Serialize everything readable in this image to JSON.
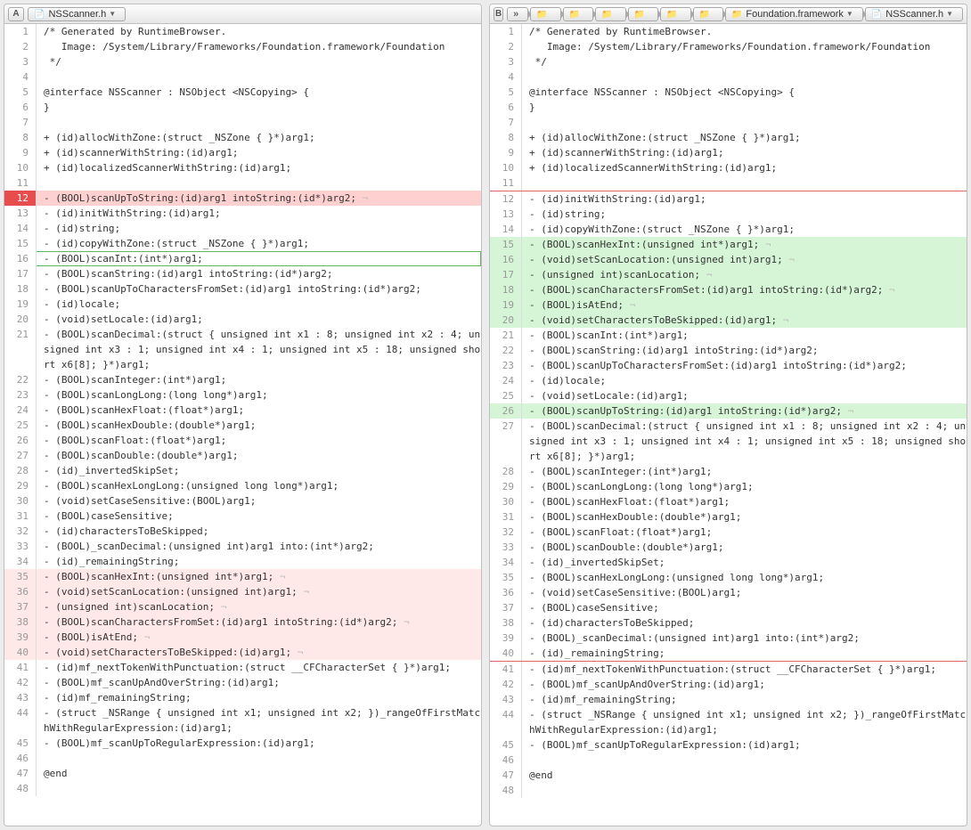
{
  "left": {
    "badge": "A",
    "filename": "NSScanner.h",
    "lines": [
      {
        "n": 1,
        "t": "/* Generated by RuntimeBrowser."
      },
      {
        "n": 2,
        "t": "   Image: /System/Library/Frameworks/Foundation.framework/Foundation"
      },
      {
        "n": 3,
        "t": " */"
      },
      {
        "n": 4,
        "t": ""
      },
      {
        "n": 5,
        "t": "@interface NSScanner : NSObject <NSCopying> {"
      },
      {
        "n": 6,
        "t": "}"
      },
      {
        "n": 7,
        "t": ""
      },
      {
        "n": 8,
        "t": "+ (id)allocWithZone:(struct _NSZone { }*)arg1;"
      },
      {
        "n": 9,
        "t": "+ (id)scannerWithString:(id)arg1;"
      },
      {
        "n": 10,
        "t": "+ (id)localizedScannerWithString:(id)arg1;"
      },
      {
        "n": 11,
        "t": ""
      },
      {
        "n": 12,
        "t": "- (BOOL)scanUpToString:(id)arg1 intoString:(id*)arg2; ¬",
        "cls": "row-del-strong"
      },
      {
        "n": 13,
        "t": "- (id)initWithString:(id)arg1;"
      },
      {
        "n": 14,
        "t": "- (id)string;"
      },
      {
        "n": 15,
        "t": "- (id)copyWithZone:(struct _NSZone { }*)arg1;"
      },
      {
        "n": 16,
        "t": "- (BOOL)scanInt:(int*)arg1;",
        "cls": "row-outline-green"
      },
      {
        "n": 17,
        "t": "- (BOOL)scanString:(id)arg1 intoString:(id*)arg2;"
      },
      {
        "n": 18,
        "t": "- (BOOL)scanUpToCharactersFromSet:(id)arg1 intoString:(id*)arg2;"
      },
      {
        "n": 19,
        "t": "- (id)locale;"
      },
      {
        "n": 20,
        "t": "- (void)setLocale:(id)arg1;"
      },
      {
        "n": 21,
        "t": "- (BOOL)scanDecimal:(struct { unsigned int x1 : 8; unsigned int x2 : 4; unsigned int x3 : 1; unsigned int x4 : 1; unsigned int x5 : 18; unsigned short x6[8]; }*)arg1;"
      },
      {
        "n": 22,
        "t": "- (BOOL)scanInteger:(int*)arg1;"
      },
      {
        "n": 23,
        "t": "- (BOOL)scanLongLong:(long long*)arg1;"
      },
      {
        "n": 24,
        "t": "- (BOOL)scanHexFloat:(float*)arg1;"
      },
      {
        "n": 25,
        "t": "- (BOOL)scanHexDouble:(double*)arg1;"
      },
      {
        "n": 26,
        "t": "- (BOOL)scanFloat:(float*)arg1;"
      },
      {
        "n": 27,
        "t": "- (BOOL)scanDouble:(double*)arg1;"
      },
      {
        "n": 28,
        "t": "- (id)_invertedSkipSet;"
      },
      {
        "n": 29,
        "t": "- (BOOL)scanHexLongLong:(unsigned long long*)arg1;"
      },
      {
        "n": 30,
        "t": "- (void)setCaseSensitive:(BOOL)arg1;"
      },
      {
        "n": 31,
        "t": "- (BOOL)caseSensitive;"
      },
      {
        "n": 32,
        "t": "- (id)charactersToBeSkipped;"
      },
      {
        "n": 33,
        "t": "- (BOOL)_scanDecimal:(unsigned int)arg1 into:(int*)arg2;"
      },
      {
        "n": 34,
        "t": "- (id)_remainingString;"
      },
      {
        "n": 35,
        "t": "- (BOOL)scanHexInt:(unsigned int*)arg1; ¬",
        "cls": "row-del"
      },
      {
        "n": 36,
        "t": "- (void)setScanLocation:(unsigned int)arg1; ¬",
        "cls": "row-del"
      },
      {
        "n": 37,
        "t": "- (unsigned int)scanLocation; ¬",
        "cls": "row-del"
      },
      {
        "n": 38,
        "t": "- (BOOL)scanCharactersFromSet:(id)arg1 intoString:(id*)arg2; ¬",
        "cls": "row-del"
      },
      {
        "n": 39,
        "t": "- (BOOL)isAtEnd; ¬",
        "cls": "row-del"
      },
      {
        "n": 40,
        "t": "- (void)setCharactersToBeSkipped:(id)arg1; ¬",
        "cls": "row-del"
      },
      {
        "n": 41,
        "t": "- (id)mf_nextTokenWithPunctuation:(struct __CFCharacterSet { }*)arg1;"
      },
      {
        "n": 42,
        "t": "- (BOOL)mf_scanUpAndOverString:(id)arg1;"
      },
      {
        "n": 43,
        "t": "- (id)mf_remainingString;"
      },
      {
        "n": 44,
        "t": "- (struct _NSRange { unsigned int x1; unsigned int x2; })_rangeOfFirstMatchWithRegularExpression:(id)arg1;"
      },
      {
        "n": 45,
        "t": "- (BOOL)mf_scanUpToRegularExpression:(id)arg1;"
      },
      {
        "n": 46,
        "t": ""
      },
      {
        "n": 47,
        "t": "@end"
      },
      {
        "n": 48,
        "t": ""
      }
    ]
  },
  "right": {
    "badge": "B",
    "crumbs": [
      {
        "type": "dbl"
      },
      {
        "type": "folder"
      },
      {
        "type": "folder"
      },
      {
        "type": "folder"
      },
      {
        "type": "folder"
      },
      {
        "type": "folder"
      },
      {
        "type": "folder"
      },
      {
        "type": "folder",
        "label": "Foundation.framework"
      },
      {
        "type": "file",
        "label": "NSScanner.h"
      }
    ],
    "lines": [
      {
        "n": 1,
        "t": "/* Generated by RuntimeBrowser."
      },
      {
        "n": 2,
        "t": "   Image: /System/Library/Frameworks/Foundation.framework/Foundation"
      },
      {
        "n": 3,
        "t": " */"
      },
      {
        "n": 4,
        "t": ""
      },
      {
        "n": 5,
        "t": "@interface NSScanner : NSObject <NSCopying> {"
      },
      {
        "n": 6,
        "t": "}"
      },
      {
        "n": 7,
        "t": ""
      },
      {
        "n": 8,
        "t": "+ (id)allocWithZone:(struct _NSZone { }*)arg1;"
      },
      {
        "n": 9,
        "t": "+ (id)scannerWithString:(id)arg1;"
      },
      {
        "n": 10,
        "t": "+ (id)localizedScannerWithString:(id)arg1;"
      },
      {
        "n": 11,
        "t": ""
      },
      {
        "n": 12,
        "t": "- (id)initWithString:(id)arg1;",
        "cls": "row-outline-red-top"
      },
      {
        "n": 13,
        "t": "- (id)string;"
      },
      {
        "n": 14,
        "t": "- (id)copyWithZone:(struct _NSZone { }*)arg1;"
      },
      {
        "n": 15,
        "t": "- (BOOL)scanHexInt:(unsigned int*)arg1; ¬",
        "cls": "row-add"
      },
      {
        "n": 16,
        "t": "- (void)setScanLocation:(unsigned int)arg1; ¬",
        "cls": "row-add"
      },
      {
        "n": 17,
        "t": "- (unsigned int)scanLocation; ¬",
        "cls": "row-add"
      },
      {
        "n": 18,
        "t": "- (BOOL)scanCharactersFromSet:(id)arg1 intoString:(id*)arg2; ¬",
        "cls": "row-add"
      },
      {
        "n": 19,
        "t": "- (BOOL)isAtEnd; ¬",
        "cls": "row-add"
      },
      {
        "n": 20,
        "t": "- (void)setCharactersToBeSkipped:(id)arg1; ¬",
        "cls": "row-add"
      },
      {
        "n": 21,
        "t": "- (BOOL)scanInt:(int*)arg1;"
      },
      {
        "n": 22,
        "t": "- (BOOL)scanString:(id)arg1 intoString:(id*)arg2;"
      },
      {
        "n": 23,
        "t": "- (BOOL)scanUpToCharactersFromSet:(id)arg1 intoString:(id*)arg2;"
      },
      {
        "n": 24,
        "t": "- (id)locale;"
      },
      {
        "n": 25,
        "t": "- (void)setLocale:(id)arg1;"
      },
      {
        "n": 26,
        "t": "- (BOOL)scanUpToString:(id)arg1 intoString:(id*)arg2; ¬",
        "cls": "row-add"
      },
      {
        "n": 27,
        "t": "- (BOOL)scanDecimal:(struct { unsigned int x1 : 8; unsigned int x2 : 4; unsigned int x3 : 1; unsigned int x4 : 1; unsigned int x5 : 18; unsigned short x6[8]; }*)arg1;"
      },
      {
        "n": 28,
        "t": "- (BOOL)scanInteger:(int*)arg1;"
      },
      {
        "n": 29,
        "t": "- (BOOL)scanLongLong:(long long*)arg1;"
      },
      {
        "n": 30,
        "t": "- (BOOL)scanHexFloat:(float*)arg1;"
      },
      {
        "n": 31,
        "t": "- (BOOL)scanHexDouble:(double*)arg1;"
      },
      {
        "n": 32,
        "t": "- (BOOL)scanFloat:(float*)arg1;"
      },
      {
        "n": 33,
        "t": "- (BOOL)scanDouble:(double*)arg1;"
      },
      {
        "n": 34,
        "t": "- (id)_invertedSkipSet;"
      },
      {
        "n": 35,
        "t": "- (BOOL)scanHexLongLong:(unsigned long long*)arg1;"
      },
      {
        "n": 36,
        "t": "- (void)setCaseSensitive:(BOOL)arg1;"
      },
      {
        "n": 37,
        "t": "- (BOOL)caseSensitive;"
      },
      {
        "n": 38,
        "t": "- (id)charactersToBeSkipped;"
      },
      {
        "n": 39,
        "t": "- (BOOL)_scanDecimal:(unsigned int)arg1 into:(int*)arg2;"
      },
      {
        "n": 40,
        "t": "- (id)_remainingString;"
      },
      {
        "n": 41,
        "t": "- (id)mf_nextTokenWithPunctuation:(struct __CFCharacterSet { }*)arg1;",
        "cls": "row-outline-red-top"
      },
      {
        "n": 42,
        "t": "- (BOOL)mf_scanUpAndOverString:(id)arg1;"
      },
      {
        "n": 43,
        "t": "- (id)mf_remainingString;"
      },
      {
        "n": 44,
        "t": "- (struct _NSRange { unsigned int x1; unsigned int x2; })_rangeOfFirstMatchWithRegularExpression:(id)arg1;"
      },
      {
        "n": 45,
        "t": "- (BOOL)mf_scanUpToRegularExpression:(id)arg1;"
      },
      {
        "n": 46,
        "t": ""
      },
      {
        "n": 47,
        "t": "@end"
      },
      {
        "n": 48,
        "t": ""
      }
    ]
  }
}
